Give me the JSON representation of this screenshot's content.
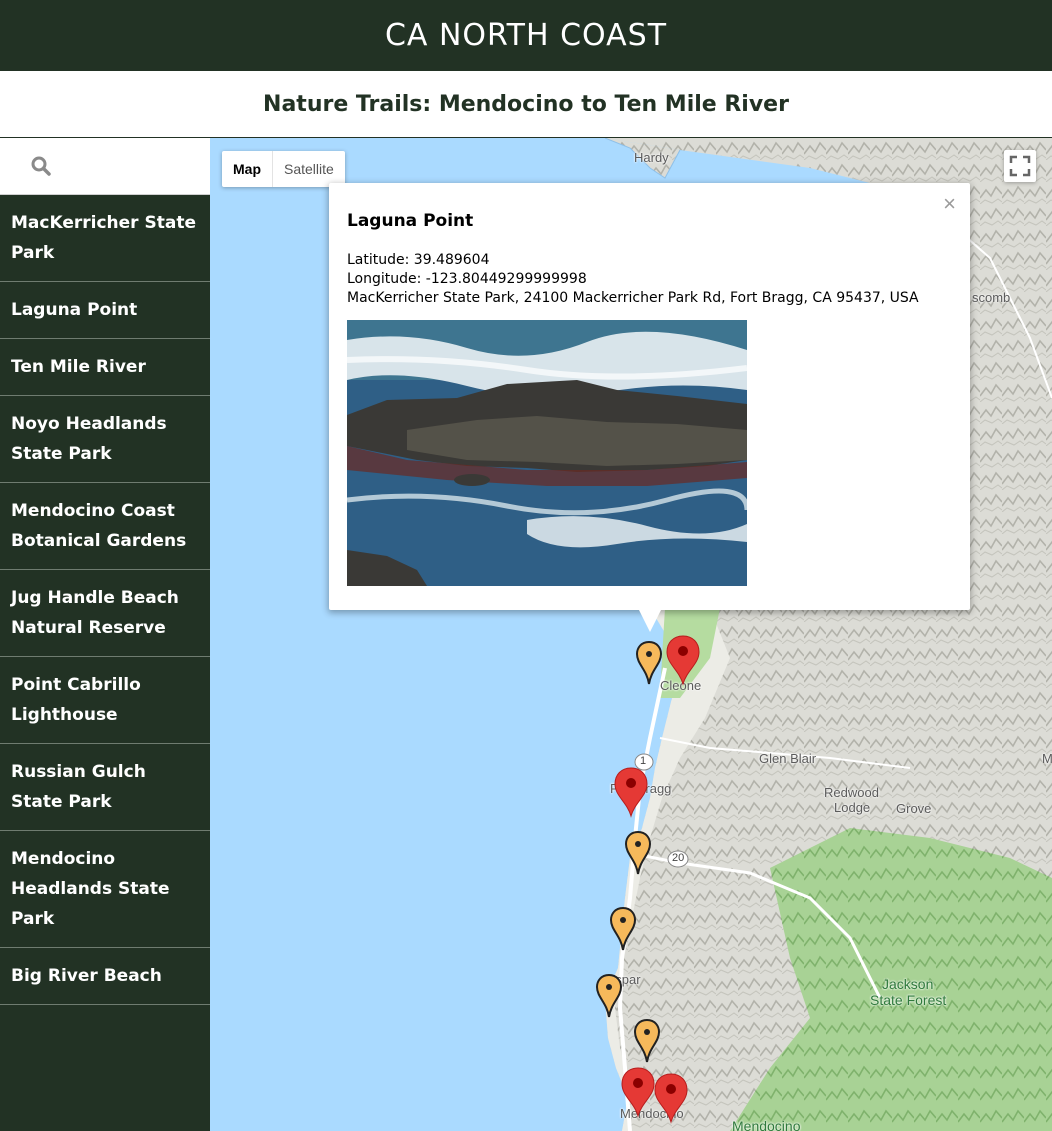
{
  "header": {
    "title": "CA NORTH COAST"
  },
  "subheader": {
    "title": "Nature Trails: Mendocino to Ten Mile River"
  },
  "search": {
    "placeholder": "",
    "value": ""
  },
  "sidebar": {
    "items": [
      {
        "label": "MacKerricher State Park"
      },
      {
        "label": "Laguna Point"
      },
      {
        "label": "Ten Mile River"
      },
      {
        "label": "Noyo Headlands State Park"
      },
      {
        "label": "Mendocino Coast Botanical Gardens"
      },
      {
        "label": "Jug Handle Beach Natural Reserve"
      },
      {
        "label": "Point Cabrillo Lighthouse"
      },
      {
        "label": "Russian Gulch State Park"
      },
      {
        "label": "Mendocino Headlands State Park"
      },
      {
        "label": "Big River Beach"
      }
    ]
  },
  "map": {
    "type_control": {
      "map": "Map",
      "satellite": "Satellite",
      "selected": "Map"
    },
    "labels": {
      "hardy": "Hardy",
      "scomb": "scomb",
      "cleone": "Cleone",
      "glen_blair": "Glen Blair",
      "redwood": "Redwood",
      "lodge": "Lodge",
      "grove": "Grove",
      "fort_bragg": "Fort Bragg",
      "caspar": "aspar",
      "mendocino_town": "Mendocino",
      "jackson1": "Jackson",
      "jackson2": "State Forest",
      "mendocino_green": "Mendocino",
      "ma": "Ma",
      "route_1": "1",
      "route_20": "20"
    },
    "colors": {
      "water": "#aadaff",
      "land": "#e8e8e2",
      "forest": "#9ccc8a",
      "pin_red": "#e53935",
      "pin_orange": "#f6b95b"
    }
  },
  "infowindow": {
    "title": "Laguna Point",
    "latitude": "Latitude: 39.489604",
    "longitude": "Longitude: -123.80449299999998",
    "address": "MacKerricher State Park, 24100 Mackerricher Park Rd, Fort Bragg, CA 95437, USA",
    "close": "×"
  }
}
